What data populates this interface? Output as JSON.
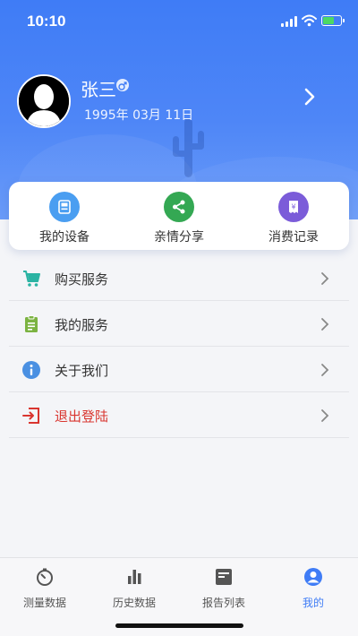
{
  "status_bar": {
    "time": "10:10"
  },
  "profile": {
    "name": "张三",
    "birthdate": "1995年 03月 11日"
  },
  "quick_actions": [
    {
      "label": "我的设备",
      "icon": "device-icon",
      "color": "#4a9ef1"
    },
    {
      "label": "亲情分享",
      "icon": "share-icon",
      "color": "#34a853"
    },
    {
      "label": "消费记录",
      "icon": "receipt-icon",
      "color": "#7b5cd9"
    }
  ],
  "menu": [
    {
      "label": "购买服务",
      "icon": "cart-icon",
      "color": "#2bb3a3"
    },
    {
      "label": "我的服务",
      "icon": "clipboard-icon",
      "color": "#7cb342"
    },
    {
      "label": "关于我们",
      "icon": "info-icon",
      "color": "#4a90e2"
    },
    {
      "label": "退出登陆",
      "icon": "logout-icon",
      "color": "#d9352f"
    }
  ],
  "tabs": [
    {
      "label": "测量数据",
      "icon": "timer-icon",
      "active": false
    },
    {
      "label": "历史数据",
      "icon": "bar-chart-icon",
      "active": false
    },
    {
      "label": "报告列表",
      "icon": "report-icon",
      "active": false
    },
    {
      "label": "我的",
      "icon": "person-icon",
      "active": true
    }
  ],
  "colors": {
    "accent": "#3f7cf6",
    "logout": "#d9352f"
  }
}
